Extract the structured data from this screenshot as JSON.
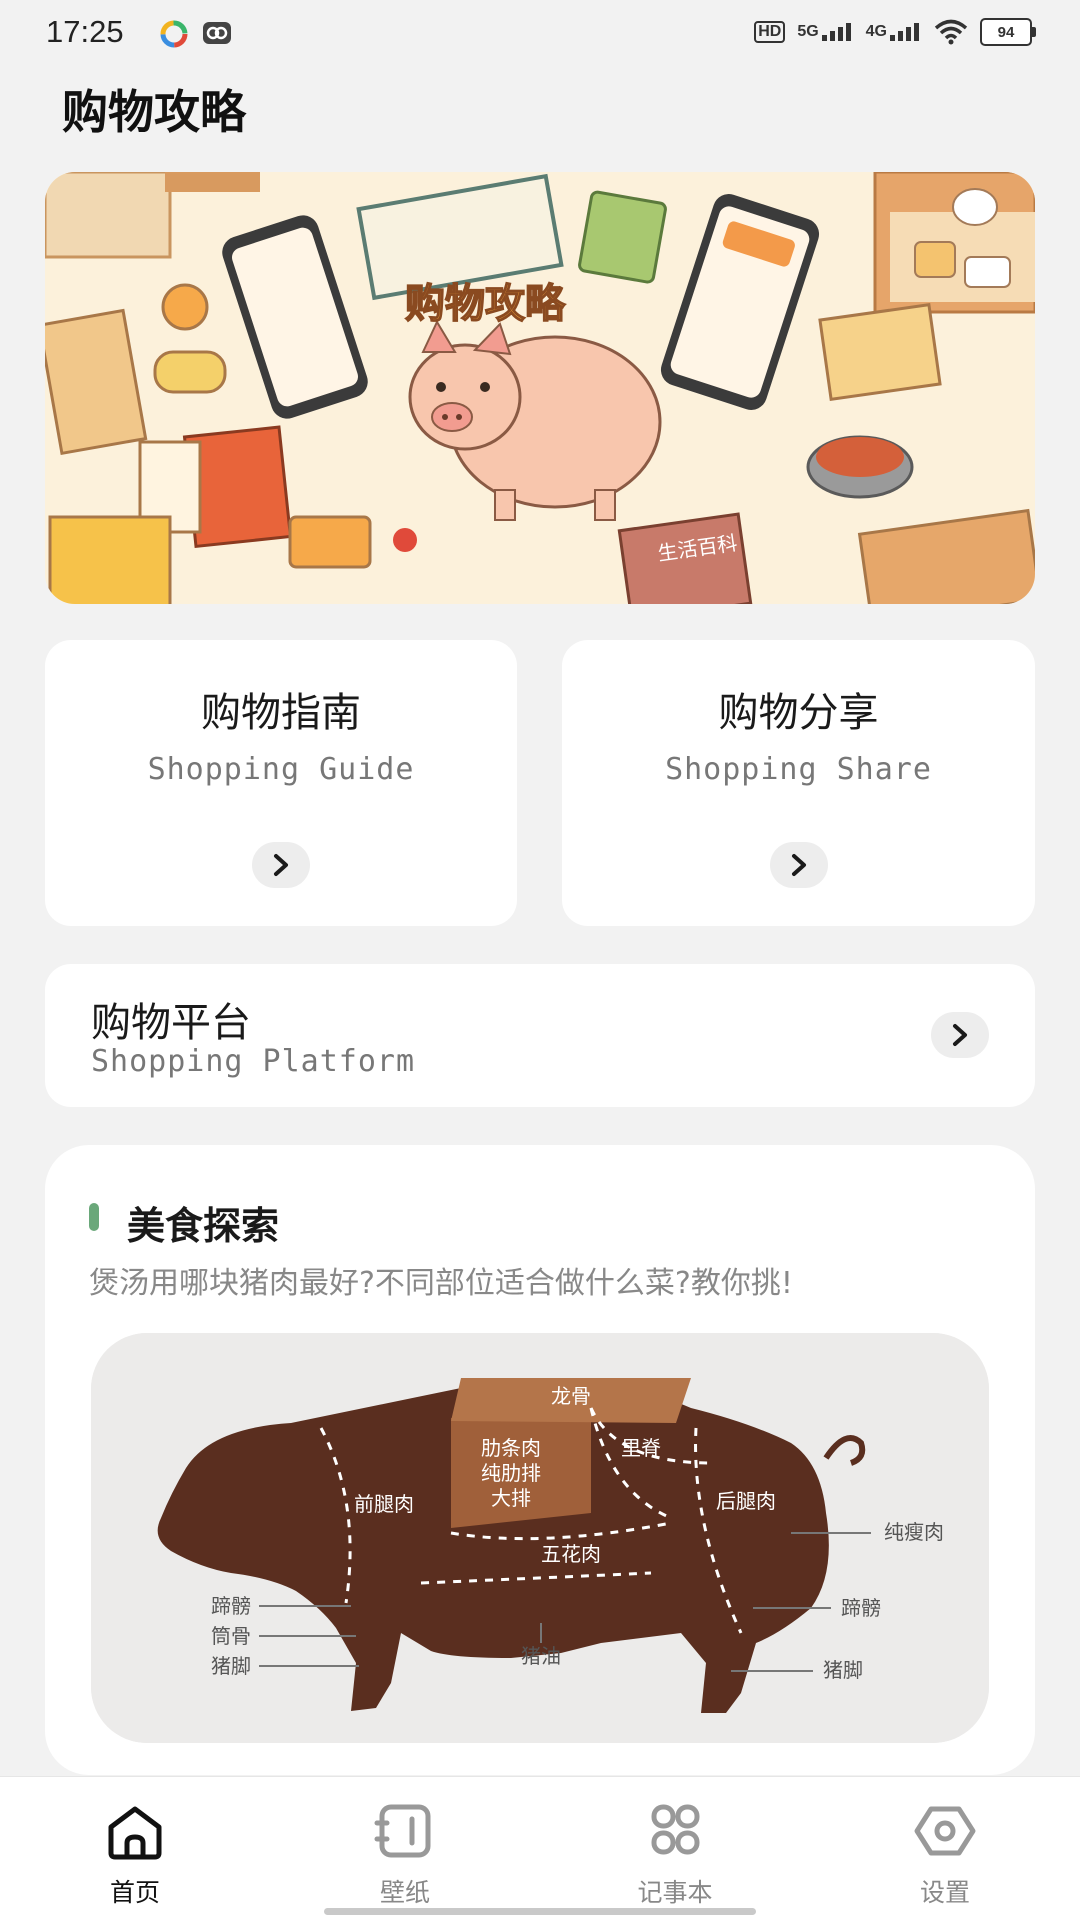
{
  "status_bar": {
    "time": "17:25",
    "network_hd": "HD",
    "network_5g": "5G",
    "network_4g": "4G",
    "battery": "94"
  },
  "header": {
    "title": "购物攻略"
  },
  "banner": {
    "title": "购物攻略",
    "book_label": "生活百科"
  },
  "cards": {
    "guide": {
      "title": "购物指南",
      "subtitle": "Shopping Guide"
    },
    "share": {
      "title": "购物分享",
      "subtitle": "Shopping Share"
    },
    "platform": {
      "title": "购物平台",
      "subtitle": "Shopping Platform"
    }
  },
  "food_section": {
    "title": "美食探索",
    "description": "煲汤用哪块猪肉最好?不同部位适合做什么菜?教你挑!",
    "diagram_labels": {
      "longgu": "龙骨",
      "leitiao": "肋条肉",
      "chunlei": "纯肋排",
      "dapai": "大排",
      "liji": "里脊",
      "qiantui": "前腿肉",
      "houtui": "后腿肉",
      "wuhua": "五花肉",
      "chunshou": "纯瘦肉",
      "tipang_front": "蹄髈",
      "tonggu": "筒骨",
      "zhujiao_front": "猪脚",
      "zhuyou": "猪油",
      "tipang_back": "蹄髈",
      "zhujiao_back": "猪脚"
    }
  },
  "tabbar": {
    "items": [
      {
        "label": "首页",
        "icon": "home-icon",
        "active": true
      },
      {
        "label": "壁纸",
        "icon": "wallpaper-icon",
        "active": false
      },
      {
        "label": "记事本",
        "icon": "notebook-icon",
        "active": false
      },
      {
        "label": "设置",
        "icon": "settings-icon",
        "active": false
      }
    ]
  },
  "colors": {
    "accent_green": "#6aa87a",
    "pig_brown": "#5a2e1f",
    "pig_highlight": "#a0603a",
    "background": "#f2f2f2"
  }
}
